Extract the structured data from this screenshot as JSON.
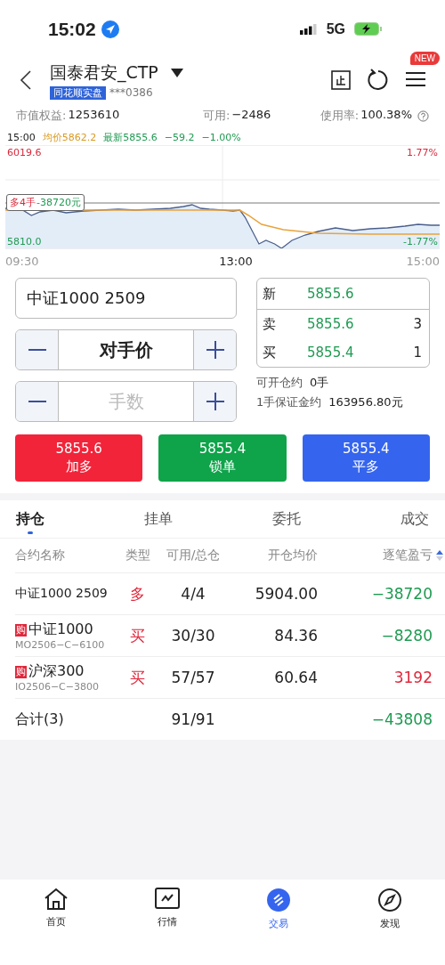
{
  "status_bar": {
    "time": "15:02",
    "network": "5G"
  },
  "header": {
    "title": "国泰君安_CTP",
    "tag": "同花顺实盘",
    "account": "***0386",
    "menu_badge": "NEW"
  },
  "account_summary": [
    {
      "label": "市值权益:",
      "value": "1253610"
    },
    {
      "label": "可用:",
      "value": "−2486"
    },
    {
      "label": "使用率:",
      "value": "100.38%"
    }
  ],
  "chart_info": {
    "time": "15:00",
    "avg": "均价5862.2",
    "latest": "最新5855.6",
    "change": "−59.2",
    "change_pct": "−1.00%"
  },
  "chart": {
    "high": "6019.6",
    "high_pct": "1.77%",
    "low": "5810.0",
    "low_pct": "-1.77%",
    "position_tag": "多4手",
    "position_pnl": "-38720元",
    "x_labels": [
      "09:30",
      "13:00",
      "15:00"
    ]
  },
  "order_form": {
    "contract": "中证1000 2509",
    "price_mode": "对手价",
    "quantity_placeholder": "手数"
  },
  "quote": [
    {
      "label": "新",
      "price": "5855.6"
    },
    {
      "label": "卖",
      "price": "5855.6",
      "volume": "3"
    },
    {
      "label": "买",
      "price": "5855.4",
      "volume": "1"
    }
  ],
  "capacity": [
    {
      "label": "可开仓约",
      "value": "0手"
    },
    {
      "label": "1手保证金约",
      "value": "163956.80元"
    }
  ],
  "actions": [
    {
      "kind": "add",
      "price": "5855.6",
      "label": "加多"
    },
    {
      "kind": "lock",
      "price": "5855.4",
      "label": "锁单"
    },
    {
      "kind": "close",
      "price": "5855.4",
      "label": "平多"
    }
  ],
  "tabs": [
    {
      "label": "持仓",
      "selected": true
    },
    {
      "label": "挂单",
      "selected": false
    },
    {
      "label": "委托",
      "selected": false
    },
    {
      "label": "成交",
      "selected": false
    }
  ],
  "table": {
    "columns": [
      "合约名称",
      "类型",
      "可用/总仓",
      "开仓均价",
      "逐笔盈亏"
    ],
    "rows": [
      {
        "name": "中证1000 2509",
        "type": "多",
        "avail": "4/4",
        "avg_price": "5904.00",
        "pnl": "−38720",
        "color": "#1f9a52"
      },
      {
        "name": "中证1000",
        "badge": "购",
        "code": "MO2506−C−6100",
        "type": "买",
        "avail": "30/30",
        "avg_price": "84.36",
        "pnl": "−8280",
        "color": "#1f9a52"
      },
      {
        "name": "沪深300",
        "badge": "购",
        "code": "IO2506−C−3800",
        "type": "买",
        "avail": "57/57",
        "avg_price": "60.64",
        "pnl": "3192",
        "color": "#e0283c"
      }
    ],
    "total": {
      "label": "合计(3)",
      "avail": "91/91",
      "pnl": "−43808",
      "color": "#1f9a52"
    }
  },
  "bottom_nav": [
    {
      "label": "首页",
      "selected": false
    },
    {
      "label": "行情",
      "selected": false
    },
    {
      "label": "交易",
      "selected": true
    },
    {
      "label": "发现",
      "selected": false
    }
  ]
}
